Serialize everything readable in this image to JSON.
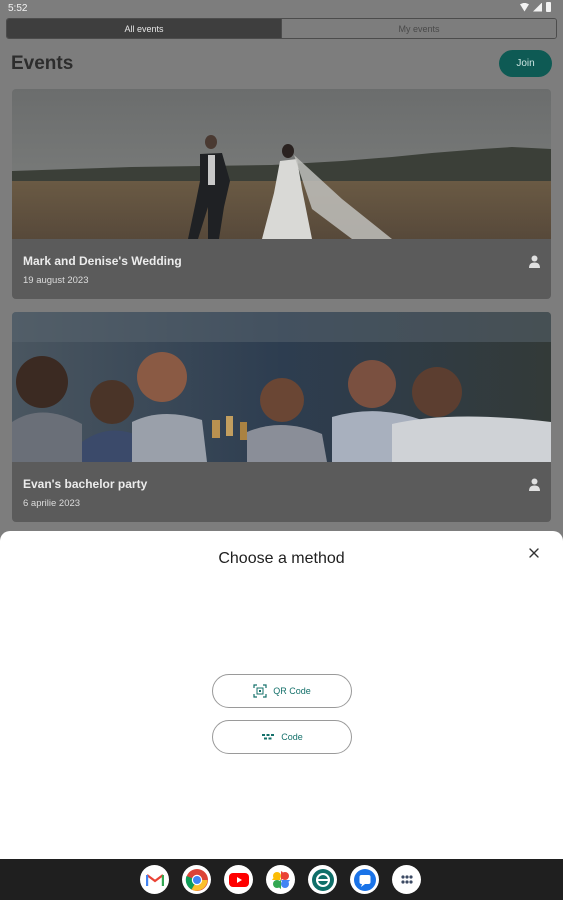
{
  "status_bar": {
    "time": "5:52",
    "icons": [
      "wifi-icon",
      "signal-icon",
      "battery-icon"
    ]
  },
  "tabs": [
    {
      "label": "All events",
      "active": true
    },
    {
      "label": "My events",
      "active": false
    }
  ],
  "header": {
    "title": "Events",
    "join_label": "Join"
  },
  "events": [
    {
      "title": "Mark and Denise's Wedding",
      "date": "19 august 2023",
      "icon": "person-icon"
    },
    {
      "title": "Evan's bachelor party",
      "date": "6 aprilie 2023",
      "icon": "person-icon"
    }
  ],
  "sheet": {
    "title": "Choose a method",
    "close_icon": "close-icon",
    "methods": [
      {
        "label": "QR Code",
        "icon": "qr-scan-icon"
      },
      {
        "label": "Code",
        "icon": "keypad-icon"
      }
    ]
  },
  "taskbar": {
    "apps": [
      "gmail-icon",
      "chrome-icon",
      "youtube-icon",
      "photos-icon",
      "app-icon",
      "messages-icon",
      "app-drawer-icon"
    ]
  },
  "colors": {
    "accent": "#14706a",
    "join_button": "#0e5a54",
    "scrim": "#7d7d7d",
    "taskbar": "#1f1f1f"
  }
}
